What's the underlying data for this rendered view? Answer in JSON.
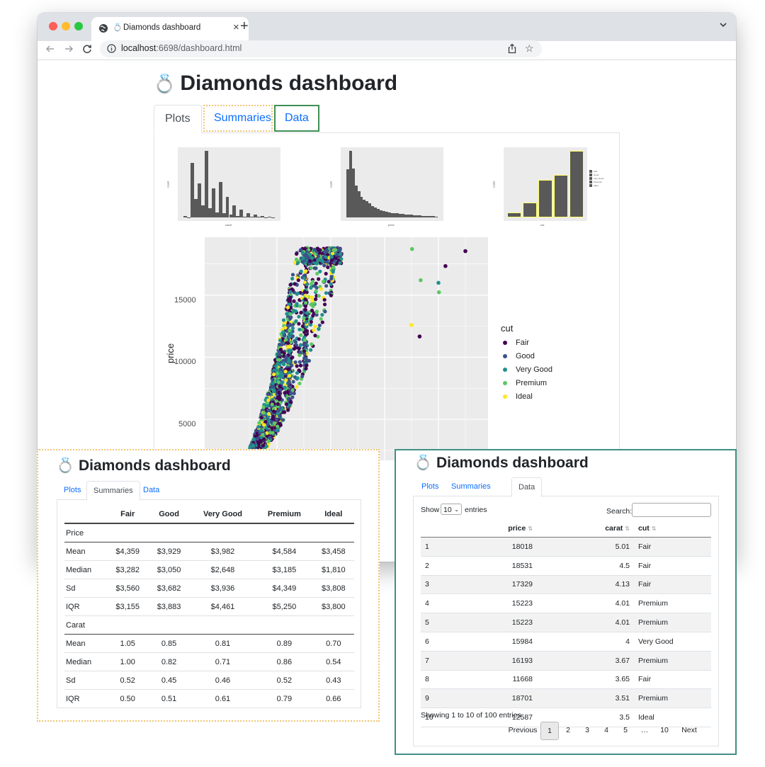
{
  "browser": {
    "tab_title": "Diamonds dashboard",
    "tab_emoji": "💍",
    "close": "×",
    "new_tab": "+",
    "url_host": "localhost",
    "url_rest": ":6698/dashboard.html"
  },
  "page": {
    "emoji": "💍",
    "title": "Diamonds dashboard",
    "tabs": [
      "Plots",
      "Summaries",
      "Data"
    ]
  },
  "colors": {
    "fair": "#440154",
    "good": "#3b528b",
    "very_good": "#21908d",
    "premium": "#5dc863",
    "ideal": "#fde725",
    "summaries_outline": "#f0c674",
    "data_outline": "#3f8f55"
  },
  "chart_data": [
    {
      "type": "bar",
      "xlabel": "carat",
      "ylabel": "count",
      "values": [
        120,
        20,
        4200,
        1400,
        2600,
        900,
        5100,
        700,
        2200,
        380,
        2700,
        300,
        1600,
        200,
        900,
        120,
        600,
        80,
        350,
        40,
        200,
        30,
        120,
        20,
        60,
        10
      ]
    },
    {
      "type": "bar",
      "xlabel": "price",
      "ylabel": "count",
      "values": [
        6800,
        9400,
        6900,
        4500,
        3700,
        2900,
        2500,
        2300,
        2000,
        1600,
        1400,
        1200,
        1000,
        900,
        800,
        700,
        650,
        600,
        560,
        520,
        480,
        430,
        400,
        370,
        340,
        300,
        280,
        250,
        220,
        200,
        180,
        160,
        140
      ]
    },
    {
      "type": "bar",
      "xlabel": "cut",
      "ylabel": "count",
      "categories": [
        "Fair",
        "Good",
        "Very Good",
        "Premium",
        "Ideal"
      ],
      "values": [
        1610,
        4906,
        12082,
        13791,
        21551
      ],
      "legend": [
        "Fair",
        "Good",
        "Very Good",
        "Premium",
        "Ideal"
      ],
      "legend_title": "cut"
    },
    {
      "type": "scatter",
      "xlabel": "",
      "ylabel": "price",
      "yticks": [
        "5000",
        "10000",
        "15000"
      ],
      "legend_title": "cut",
      "legend": [
        "Fair",
        "Good",
        "Very Good",
        "Premium",
        "Ideal"
      ],
      "outliers": [
        {
          "x": 4.5,
          "y": 18531,
          "cut": "Fair"
        },
        {
          "x": 5.01,
          "y": 18018,
          "cut": "Fair"
        },
        {
          "x": 4.13,
          "y": 17329,
          "cut": "Fair"
        },
        {
          "x": 4.01,
          "y": 15223,
          "cut": "Premium"
        },
        {
          "x": 3.67,
          "y": 16193,
          "cut": "Premium"
        },
        {
          "x": 3.51,
          "y": 18701,
          "cut": "Premium"
        },
        {
          "x": 3.65,
          "y": 11668,
          "cut": "Fair"
        },
        {
          "x": 3.5,
          "y": 12587,
          "cut": "Ideal"
        },
        {
          "x": 4.0,
          "y": 15984,
          "cut": "Very Good"
        }
      ]
    }
  ],
  "summaries": {
    "emoji": "💍",
    "title": "Diamonds dashboard",
    "tabs": [
      "Plots",
      "Summaries",
      "Data"
    ],
    "columns": [
      "",
      "Fair",
      "Good",
      "Very Good",
      "Premium",
      "Ideal"
    ],
    "groups": [
      {
        "name": "Price",
        "rows": [
          [
            "Mean",
            "$4,359",
            "$3,929",
            "$3,982",
            "$4,584",
            "$3,458"
          ],
          [
            "Median",
            "$3,282",
            "$3,050",
            "$2,648",
            "$3,185",
            "$1,810"
          ],
          [
            "Sd",
            "$3,560",
            "$3,682",
            "$3,936",
            "$4,349",
            "$3,808"
          ],
          [
            "IQR",
            "$3,155",
            "$3,883",
            "$4,461",
            "$5,250",
            "$3,800"
          ]
        ]
      },
      {
        "name": "Carat",
        "rows": [
          [
            "Mean",
            "1.05",
            "0.85",
            "0.81",
            "0.89",
            "0.70"
          ],
          [
            "Median",
            "1.00",
            "0.82",
            "0.71",
            "0.86",
            "0.54"
          ],
          [
            "Sd",
            "0.52",
            "0.45",
            "0.46",
            "0.52",
            "0.43"
          ],
          [
            "IQR",
            "0.50",
            "0.51",
            "0.61",
            "0.79",
            "0.66"
          ]
        ]
      }
    ]
  },
  "data_view": {
    "emoji": "💍",
    "title": "Diamonds dashboard",
    "tabs": [
      "Plots",
      "Summaries",
      "Data"
    ],
    "show_label": "Show",
    "show_value": "10",
    "entries_label": "entries",
    "search_label": "Search:",
    "columns": [
      "",
      "price",
      "carat",
      "cut"
    ],
    "rows": [
      [
        "1",
        "18018",
        "5.01",
        "Fair"
      ],
      [
        "2",
        "18531",
        "4.5",
        "Fair"
      ],
      [
        "3",
        "17329",
        "4.13",
        "Fair"
      ],
      [
        "4",
        "15223",
        "4.01",
        "Premium"
      ],
      [
        "5",
        "15223",
        "4.01",
        "Premium"
      ],
      [
        "6",
        "15984",
        "4",
        "Very Good"
      ],
      [
        "7",
        "16193",
        "3.67",
        "Premium"
      ],
      [
        "8",
        "11668",
        "3.65",
        "Fair"
      ],
      [
        "9",
        "18701",
        "3.51",
        "Premium"
      ],
      [
        "10",
        "12587",
        "3.5",
        "Ideal"
      ]
    ],
    "info": "Showing 1 to 10 of 100 entries",
    "pagination": [
      "Previous",
      "1",
      "2",
      "3",
      "4",
      "5",
      "…",
      "10",
      "Next"
    ]
  }
}
